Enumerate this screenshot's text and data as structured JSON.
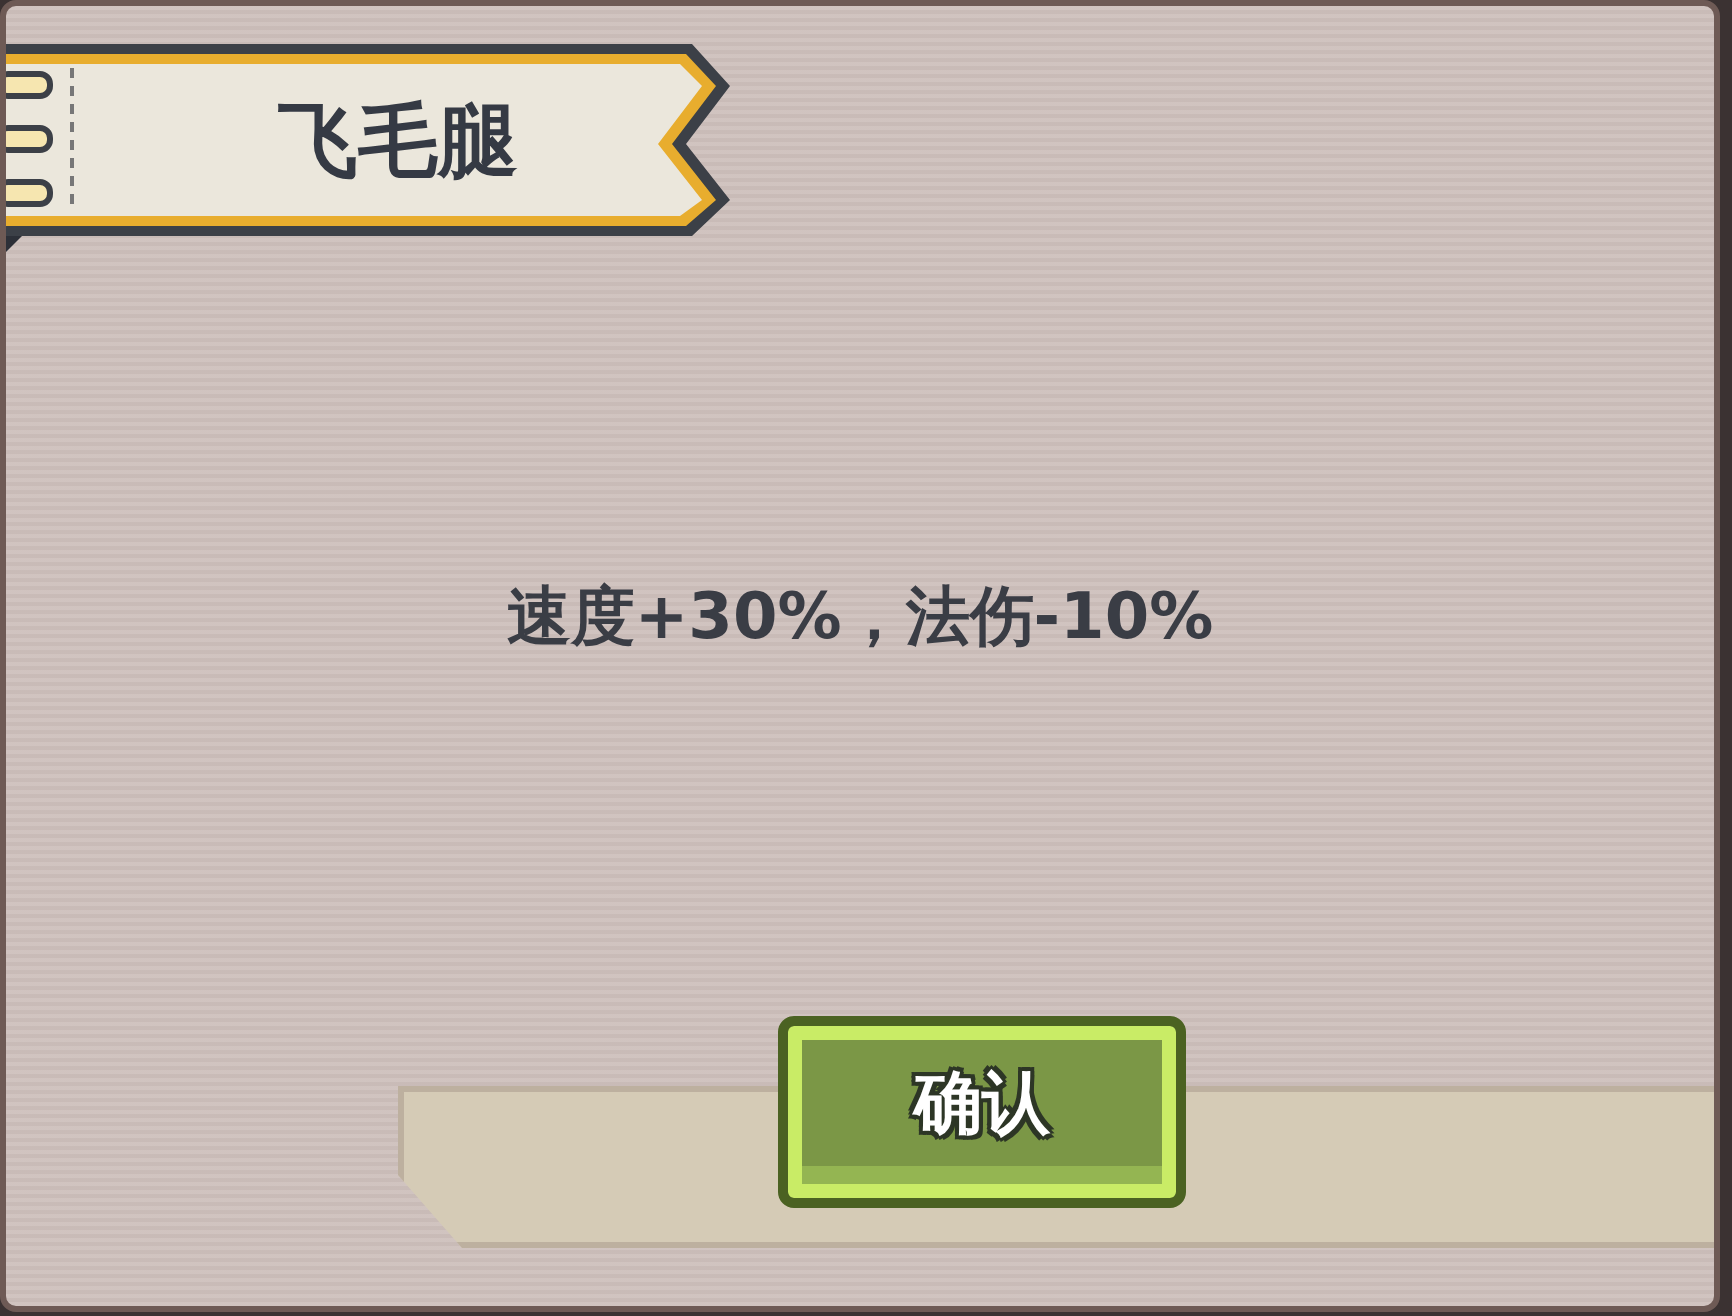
{
  "title": "飞毛腿",
  "description": "速度+30%，法伤-10%",
  "confirm_button": "确认"
}
